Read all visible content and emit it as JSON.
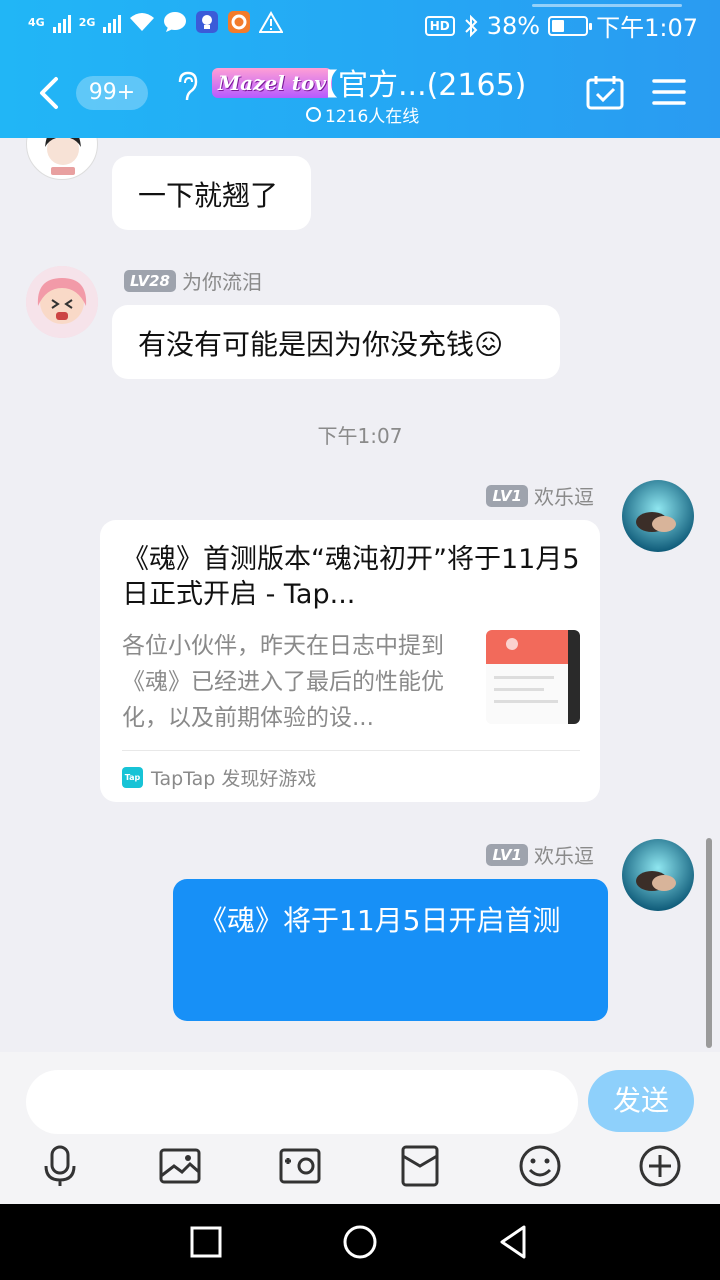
{
  "status_bar": {
    "net1": "4G",
    "net2": "2G",
    "battery": "38%",
    "time": "下午1:07",
    "hd": "HD"
  },
  "header": {
    "badge": "99+",
    "logo_text": "Mazel tov",
    "title": "【官方...(2165)",
    "online": "1216人在线",
    "accent": "#24a8f5"
  },
  "messages": [
    {
      "side": "left",
      "text": "一下就翘了"
    },
    {
      "side": "left",
      "level": "LV28",
      "sender": "为你流泪",
      "text": "有没有可能是因为你没充钱😖"
    },
    {
      "type": "timestamp",
      "text": "下午1:07"
    },
    {
      "side": "right",
      "level": "LV1",
      "sender": "欢乐逗",
      "type": "link_card",
      "card": {
        "title": "《魂》首测版本“魂沌初开”将于11月5日正式开启 - Tap...",
        "desc": "各位小伙伴，昨天在日志中提到《魂》已经进入了最后的性能优化，以及前期体验的设...",
        "source": "TapTap 发现好游戏",
        "source_icon": "Tap"
      }
    },
    {
      "side": "right",
      "level": "LV1",
      "sender": "欢乐逗",
      "text": "《魂》将于11月5日开启首测",
      "bubble_color": "#1790f7"
    }
  ],
  "input": {
    "placeholder": "",
    "send_label": "发送"
  },
  "toolbar": [
    "microphone-icon",
    "picture-icon",
    "camera-icon",
    "red-packet-icon",
    "emoji-icon",
    "plus-icon"
  ]
}
